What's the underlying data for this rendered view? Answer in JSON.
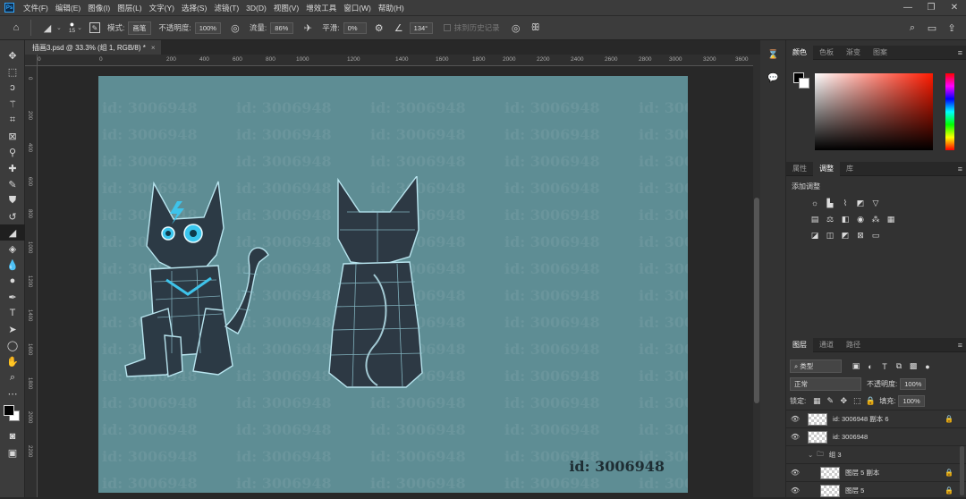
{
  "app": {
    "logo": "Ps"
  },
  "menu": [
    "文件(F)",
    "编辑(E)",
    "图像(I)",
    "图层(L)",
    "文字(Y)",
    "选择(S)",
    "滤镜(T)",
    "3D(D)",
    "视图(V)",
    "增效工具",
    "窗口(W)",
    "帮助(H)"
  ],
  "window_controls": [
    "—",
    "❐",
    "✕"
  ],
  "options": {
    "brush_size": "15",
    "mode_label": "模式:",
    "mode_value": "画笔",
    "opacity_label": "不透明度:",
    "opacity_value": "100%",
    "flow_label": "流量:",
    "flow_value": "86%",
    "smoothing_label": "平滑:",
    "smoothing_value": "0%",
    "angle_value": "134°",
    "erase_history_label": "抹到历史记录"
  },
  "document_tab": {
    "title": "插画3.psd @ 33.3% (组 1, RGB/8) *",
    "close": "×"
  },
  "ruler_top": [
    "0",
    "0",
    "200",
    "400",
    "600",
    "800",
    "1000",
    "1200",
    "1400",
    "1600",
    "1800",
    "2000",
    "2200",
    "2400",
    "2600",
    "2800",
    "3000",
    "3200",
    "3400",
    "3600",
    "3800"
  ],
  "ruler_left": [
    "0",
    "200",
    "400",
    "600",
    "800",
    "1000",
    "1200",
    "1400",
    "1600",
    "1800",
    "2000",
    "2200"
  ],
  "canvas": {
    "background_color": "#5e8d94",
    "watermark_text": "id: 3006948",
    "id_label": "id: 3006948"
  },
  "color_panel": {
    "tabs": [
      "颜色",
      "色板",
      "渐变",
      "图案"
    ],
    "active": "颜色"
  },
  "adjust_panel": {
    "tabs": [
      "属性",
      "调整",
      "库"
    ],
    "active": "调整",
    "title": "添加调整"
  },
  "layers_panel": {
    "tabs": [
      "图层",
      "通道",
      "路径"
    ],
    "active": "图层",
    "filter_label": "类型",
    "blend_mode": "正常",
    "opacity_label": "不透明度:",
    "opacity_value": "100%",
    "lock_label": "锁定:",
    "fill_label": "填充:",
    "fill_value": "100%",
    "layers": [
      {
        "name": "id: 3006948 副本 6",
        "visible": true,
        "locked": true,
        "indent": false
      },
      {
        "name": "id: 3006948",
        "visible": true,
        "locked": false,
        "indent": false
      },
      {
        "name": "组 3",
        "visible": false,
        "group": true,
        "indent": false
      },
      {
        "name": "图层 5 副本",
        "visible": true,
        "locked": true,
        "indent": true
      },
      {
        "name": "图层 5",
        "visible": true,
        "locked": true,
        "indent": true
      }
    ]
  }
}
